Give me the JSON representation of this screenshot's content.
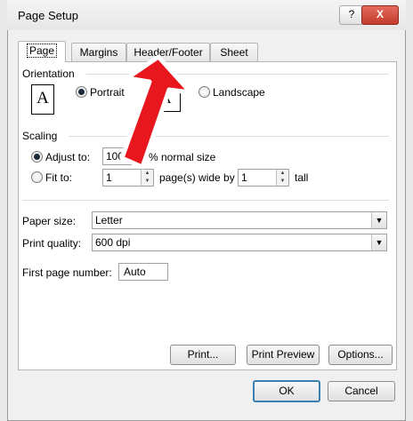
{
  "window": {
    "title": "Page Setup",
    "help_label": "?",
    "close_label": "X"
  },
  "tabs": [
    {
      "label": "Page"
    },
    {
      "label": "Margins"
    },
    {
      "label": "Header/Footer"
    },
    {
      "label": "Sheet"
    }
  ],
  "orientation": {
    "heading": "Orientation",
    "portrait_label": "Portrait",
    "landscape_label": "Landscape",
    "glyph": "A",
    "selected": "portrait"
  },
  "scaling": {
    "heading": "Scaling",
    "adjust_label": "Adjust to:",
    "adjust_value": "100",
    "adjust_suffix": "% normal size",
    "fit_label": "Fit to:",
    "fit_wide_value": "1",
    "fit_mid_label": "page(s) wide by",
    "fit_tall_value": "1",
    "fit_tall_suffix": "tall",
    "selected": "adjust"
  },
  "paper": {
    "paper_size_label": "Paper size:",
    "paper_size_value": "Letter",
    "print_quality_label": "Print quality:",
    "print_quality_value": "600 dpi",
    "first_page_label": "First page number:",
    "first_page_value": "Auto"
  },
  "buttons": {
    "print": "Print...",
    "print_preview": "Print Preview",
    "options": "Options...",
    "ok": "OK",
    "cancel": "Cancel"
  },
  "colors": {
    "annotation_arrow": "#e8161d",
    "default_button_border": "#3c7fb1"
  }
}
